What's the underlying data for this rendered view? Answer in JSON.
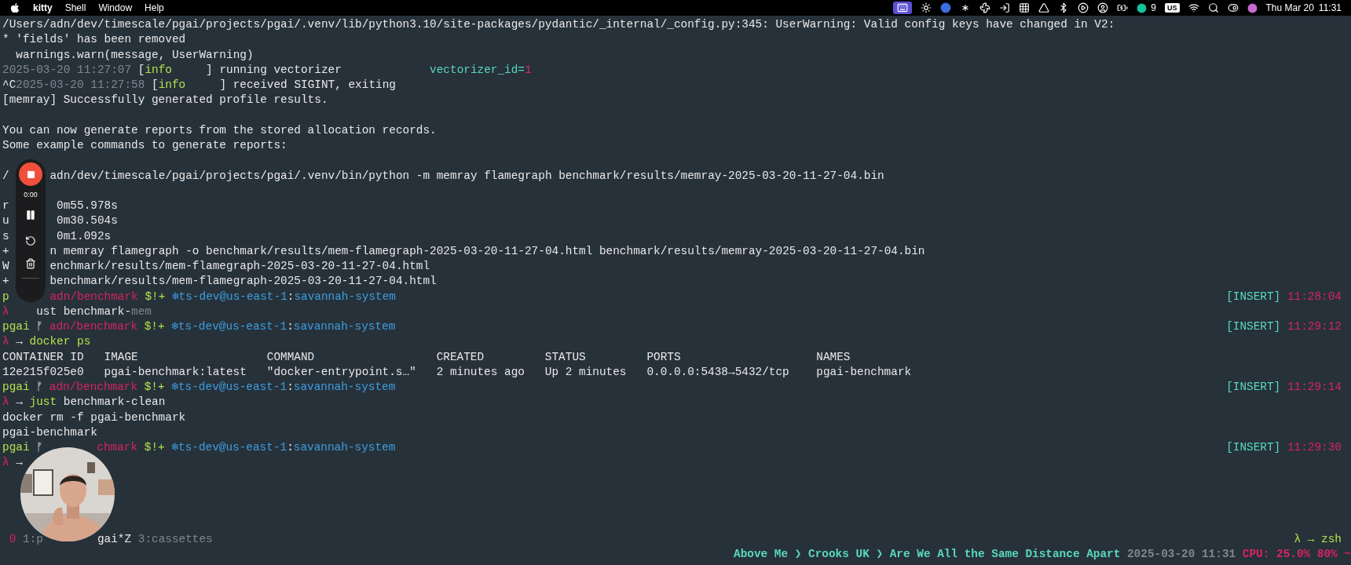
{
  "menu_bar": {
    "app_name": "kitty",
    "menus": [
      "Shell",
      "Window",
      "Help"
    ],
    "notification_count": "9",
    "input_source": "US",
    "date": "Thu Mar 20",
    "time": "11:31"
  },
  "recorder": {
    "elapsed": "0:00"
  },
  "terminal": {
    "lines": [
      {
        "kind": "output",
        "segments": [
          {
            "kind": "text",
            "text": "/Users/adn/dev/timescale/pgai/projects/pgai/.venv/lib/python3.10/site-packages/pydantic/_internal/_config.py:345: UserWarning: Valid config keys have changed in V2:"
          }
        ]
      },
      {
        "kind": "output",
        "segments": [
          {
            "kind": "text",
            "text": "* 'fields' has been removed"
          }
        ]
      },
      {
        "kind": "output",
        "segments": [
          {
            "kind": "text",
            "text": "  warnings.warn(message, UserWarning)"
          }
        ]
      },
      {
        "kind": "output",
        "segments": [
          {
            "kind": "dim",
            "text": "2025-03-20 11:27:07 "
          },
          {
            "kind": "text",
            "text": "["
          },
          {
            "kind": "ok",
            "text": "info"
          },
          {
            "kind": "text",
            "text": "     ] running vectorizer             "
          },
          {
            "kind": "key",
            "text": "vectorizer_id="
          },
          {
            "kind": "error",
            "text": "1"
          }
        ]
      },
      {
        "kind": "output",
        "segments": [
          {
            "kind": "text",
            "text": "^C"
          },
          {
            "kind": "dim",
            "text": "2025-03-20 11:27:58 "
          },
          {
            "kind": "text",
            "text": "["
          },
          {
            "kind": "ok",
            "text": "info"
          },
          {
            "kind": "text",
            "text": "     ] received SIGINT, exiting"
          }
        ]
      },
      {
        "kind": "output",
        "segments": [
          {
            "kind": "text",
            "text": "[memray] Successfully generated profile results."
          }
        ]
      },
      {
        "kind": "blank"
      },
      {
        "kind": "output",
        "segments": [
          {
            "kind": "text",
            "text": "You can now generate reports from the stored allocation records."
          }
        ]
      },
      {
        "kind": "output",
        "segments": [
          {
            "kind": "text",
            "text": "Some example commands to generate reports:"
          }
        ]
      },
      {
        "kind": "blank"
      },
      {
        "kind": "output",
        "segments": [
          {
            "kind": "text",
            "text": "/"
          },
          {
            "kind": "text",
            "text": "      adn/dev/timescale/pgai/projects/pgai/.venv/bin/python -m memray flamegraph benchmark/results/memray-2025-03-20-11-27-04.bin"
          }
        ]
      },
      {
        "kind": "blank"
      },
      {
        "kind": "output",
        "segments": [
          {
            "kind": "text",
            "text": "r"
          },
          {
            "kind": "text",
            "text": "       0m55.978s"
          }
        ]
      },
      {
        "kind": "output",
        "segments": [
          {
            "kind": "text",
            "text": "u"
          },
          {
            "kind": "text",
            "text": "       0m30.504s"
          }
        ]
      },
      {
        "kind": "output",
        "segments": [
          {
            "kind": "text",
            "text": "s"
          },
          {
            "kind": "text",
            "text": "       0m1.092s"
          }
        ]
      },
      {
        "kind": "output",
        "segments": [
          {
            "kind": "text",
            "text": "+"
          },
          {
            "kind": "text",
            "text": "      n memray flamegraph -o benchmark/results/mem-flamegraph-2025-03-20-11-27-04.html benchmark/results/memray-2025-03-20-11-27-04.bin"
          }
        ]
      },
      {
        "kind": "output",
        "segments": [
          {
            "kind": "text",
            "text": "W"
          },
          {
            "kind": "text",
            "text": "      enchmark/results/mem-flamegraph-2025-03-20-11-27-04.html"
          }
        ]
      },
      {
        "kind": "output",
        "segments": [
          {
            "kind": "text",
            "text": "+"
          },
          {
            "kind": "text",
            "text": "      benchmark/results/mem-flamegraph-2025-03-20-11-27-04.html"
          }
        ]
      },
      {
        "kind": "prompt",
        "segments": [
          {
            "kind": "ok",
            "text": "p"
          },
          {
            "kind": "accent",
            "text": "      adn/benchmark"
          },
          {
            "kind": "ok",
            "text": " $!+ "
          },
          {
            "kind": "link",
            "text": "❄ts-dev@us-east-1"
          },
          {
            "kind": "text",
            "text": ":"
          },
          {
            "kind": "link",
            "text": "savannah-system"
          }
        ],
        "right": [
          {
            "kind": "key",
            "text": "[INSERT]"
          },
          {
            "kind": "accent",
            "text": " 11:28:04"
          }
        ]
      },
      {
        "kind": "output",
        "segments": [
          {
            "kind": "error",
            "text": "λ"
          },
          {
            "kind": "text",
            "text": "    ust benchmark-"
          },
          {
            "kind": "dim",
            "text": "mem"
          }
        ]
      },
      {
        "kind": "prompt",
        "segments": [
          {
            "kind": "ok",
            "text": "pgai"
          },
          {
            "kind": "text",
            "text": " ᚠ "
          },
          {
            "kind": "accent",
            "text": "adn/benchmark"
          },
          {
            "kind": "ok",
            "text": " $!+ "
          },
          {
            "kind": "link",
            "text": "❄ts-dev@us-east-1"
          },
          {
            "kind": "text",
            "text": ":"
          },
          {
            "kind": "link",
            "text": "savannah-system"
          }
        ],
        "right": [
          {
            "kind": "key",
            "text": "[INSERT]"
          },
          {
            "kind": "accent",
            "text": " 11:29:12"
          }
        ]
      },
      {
        "kind": "output",
        "segments": [
          {
            "kind": "error",
            "text": "λ"
          },
          {
            "kind": "text",
            "text": " → "
          },
          {
            "kind": "ok",
            "text": "docker ps"
          }
        ]
      },
      {
        "kind": "table_header",
        "cells": [
          "CONTAINER ID",
          "IMAGE",
          "COMMAND",
          "CREATED",
          "STATUS",
          "PORTS",
          "NAMES"
        ]
      },
      {
        "kind": "table_row",
        "cells": [
          "12e215f025e0",
          "pgai-benchmark:latest",
          "\"docker-entrypoint.s…\"",
          "2 minutes ago",
          "Up 2 minutes",
          "0.0.0.0:5438→5432/tcp",
          "pgai-benchmark"
        ]
      },
      {
        "kind": "prompt",
        "segments": [
          {
            "kind": "ok",
            "text": "pgai"
          },
          {
            "kind": "text",
            "text": " ᚠ "
          },
          {
            "kind": "accent",
            "text": "adn/benchmark"
          },
          {
            "kind": "ok",
            "text": " $!+ "
          },
          {
            "kind": "link",
            "text": "❄ts-dev@us-east-1"
          },
          {
            "kind": "text",
            "text": ":"
          },
          {
            "kind": "link",
            "text": "savannah-system"
          }
        ],
        "right": [
          {
            "kind": "key",
            "text": "[INSERT]"
          },
          {
            "kind": "accent",
            "text": " 11:29:14"
          }
        ]
      },
      {
        "kind": "output",
        "segments": [
          {
            "kind": "error",
            "text": "λ"
          },
          {
            "kind": "text",
            "text": " → "
          },
          {
            "kind": "ok",
            "text": "just"
          },
          {
            "kind": "text",
            "text": " benchmark-clean"
          }
        ]
      },
      {
        "kind": "output",
        "segments": [
          {
            "kind": "text",
            "text": "docker rm -f pgai-benchmark"
          }
        ]
      },
      {
        "kind": "output",
        "segments": [
          {
            "kind": "text",
            "text": "pgai-benchmark"
          }
        ]
      },
      {
        "kind": "prompt",
        "segments": [
          {
            "kind": "ok",
            "text": "pgai"
          },
          {
            "kind": "text",
            "text": " ᚠ"
          },
          {
            "kind": "accent",
            "text": "        chmark"
          },
          {
            "kind": "ok",
            "text": " $!+ "
          },
          {
            "kind": "link",
            "text": "❄ts-dev@us-east-1"
          },
          {
            "kind": "text",
            "text": ":"
          },
          {
            "kind": "link",
            "text": "savannah-system"
          }
        ],
        "right": [
          {
            "kind": "key",
            "text": "[INSERT]"
          },
          {
            "kind": "accent",
            "text": " 11:29:30"
          }
        ]
      },
      {
        "kind": "output",
        "segments": [
          {
            "kind": "error",
            "text": "λ"
          },
          {
            "kind": "text",
            "text": " →"
          }
        ]
      }
    ]
  },
  "tmux_status": {
    "left": [
      {
        "kind": "accent",
        "text": " 0"
      },
      {
        "kind": "dim",
        "text": " 1:p"
      },
      {
        "kind": "text",
        "text": "        gai*Z"
      },
      {
        "kind": "dim",
        "text": " 3:cassettes"
      }
    ],
    "right": [
      {
        "kind": "ok",
        "text": "λ → zsh"
      }
    ]
  },
  "bottom_status": {
    "segments": [
      {
        "kind": "key",
        "text": "Above Me ❯ Crooks UK ❯ Are We All the Same Distance Apart"
      },
      {
        "kind": "dim",
        "text": " 2025-03-20 11:31 "
      },
      {
        "kind": "accent",
        "text": "CPU: 25.0% 80% ~"
      }
    ]
  }
}
